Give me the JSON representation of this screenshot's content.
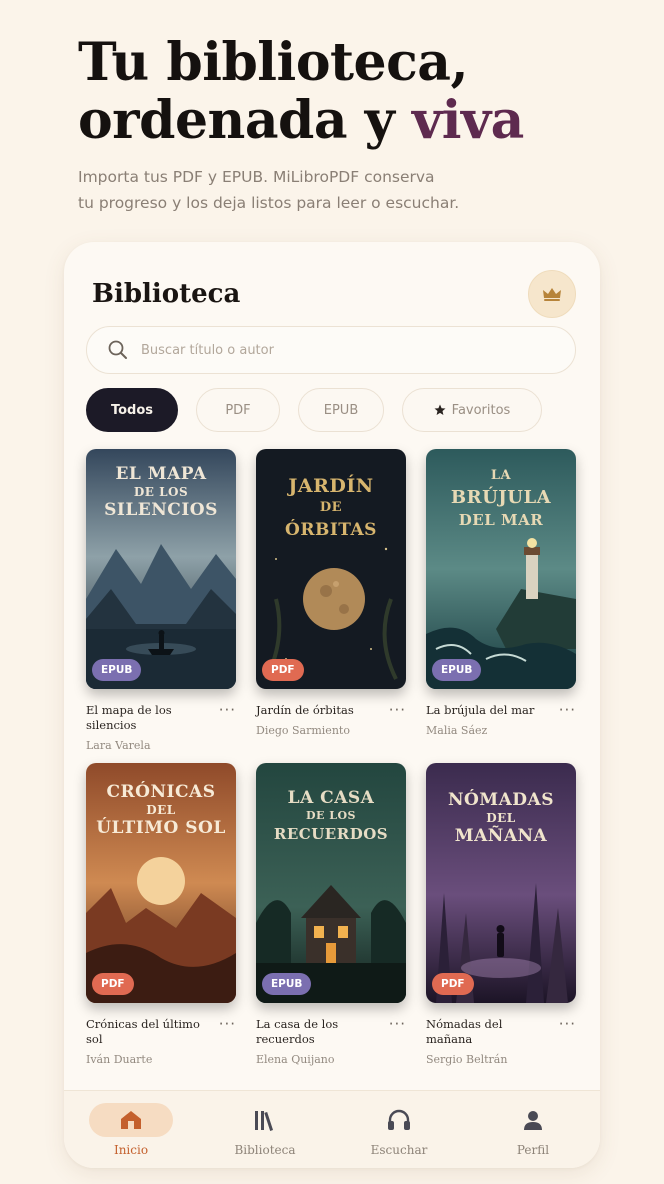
{
  "hero": {
    "title_line1": "Tu biblioteca,",
    "title_line2_main": "ordenada y ",
    "title_line2_accent": "viva",
    "subtitle_line1": "Importa tus PDF y EPUB. MiLibroPDF conserva",
    "subtitle_line2": "tu progreso y los deja listos para leer o escuchar."
  },
  "library": {
    "title": "Biblioteca",
    "premium_icon": "crown-icon",
    "search_placeholder": "Buscar título o autor",
    "filters": [
      {
        "label": "Todos",
        "active": true
      },
      {
        "label": "PDF",
        "active": false
      },
      {
        "label": "EPUB",
        "active": false
      },
      {
        "label": "Favoritos",
        "active": false,
        "icon": "star-icon"
      }
    ],
    "books": [
      {
        "cover_line1": "El mapa",
        "cover_line2": "de los",
        "cover_line3": "silencios",
        "format": "EPUB",
        "name": "El mapa de los silencios",
        "author": "Lara Varela"
      },
      {
        "cover_line1": "Jardín",
        "cover_line2": "de",
        "cover_line3": "órbitas",
        "format": "PDF",
        "name": "Jardín de órbitas",
        "author": "Diego Sarmiento"
      },
      {
        "cover_line1": "La",
        "cover_line2": "brújula",
        "cover_line3": "del mar",
        "format": "EPUB",
        "name": "La brújula del mar",
        "author": "Malia Sáez"
      },
      {
        "cover_line1": "Crónicas",
        "cover_line2": "del",
        "cover_line3": "último sol",
        "format": "PDF",
        "name": "Crónicas del último sol",
        "author": "Iván Duarte"
      },
      {
        "cover_line1": "La casa",
        "cover_line2": "de los",
        "cover_line3": "recuerdos",
        "format": "EPUB",
        "name": "La casa de los recuerdos",
        "author": "Elena Quijano"
      },
      {
        "cover_line1": "Nómadas",
        "cover_line2": "del",
        "cover_line3": "mañana",
        "format": "PDF",
        "name": "Nómadas del mañana",
        "author": "Sergio Beltrán"
      }
    ],
    "more_label": "···"
  },
  "tabbar": {
    "tabs": [
      {
        "label": "Inicio",
        "icon": "home-icon",
        "active": true
      },
      {
        "label": "Biblioteca",
        "icon": "books-icon",
        "active": false
      },
      {
        "label": "Escuchar",
        "icon": "headphones-icon",
        "active": false
      },
      {
        "label": "Perfil",
        "icon": "user-icon",
        "active": false
      }
    ]
  },
  "colors": {
    "background": "#fbf4ea",
    "accent_purple": "#5e2a4f",
    "active_chip": "#1c1a27",
    "tab_active": "#c4602d",
    "badge_epub": "#7b6fb0",
    "badge_pdf": "#e06a52"
  }
}
